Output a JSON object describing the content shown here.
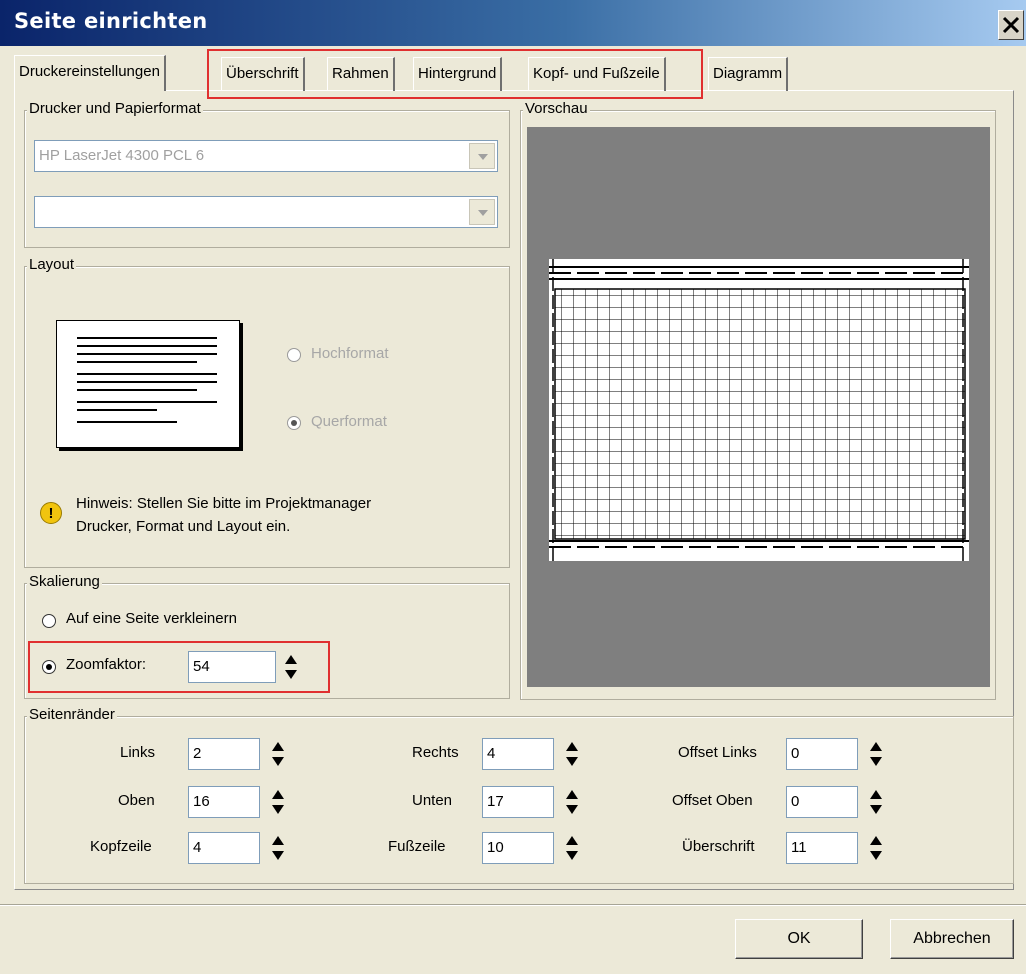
{
  "window": {
    "title": "Seite einrichten"
  },
  "tabs": [
    {
      "label": "Druckereinstellungen",
      "active": true
    },
    {
      "label": "Überschrift"
    },
    {
      "label": "Rahmen"
    },
    {
      "label": "Hintergrund"
    },
    {
      "label": "Kopf- und Fußzeile"
    },
    {
      "label": "Diagramm"
    }
  ],
  "printer": {
    "group_title": "Drucker und Papierformat",
    "printer_value": "HP LaserJet 4300 PCL 6",
    "paper_value": ""
  },
  "layout": {
    "group_title": "Layout",
    "portrait_label": "Hochformat",
    "landscape_label": "Querformat",
    "selected": "Querformat",
    "hint": "Hinweis: Stellen Sie bitte im Projektmanager",
    "hint_line2": "Drucker, Format und Layout ein."
  },
  "scaling": {
    "group_title": "Skalierung",
    "fit_label": "Auf eine Seite verkleinern",
    "zoom_label": "Zoomfaktor:",
    "zoom_value": "54",
    "selected": "Zoomfaktor"
  },
  "preview": {
    "group_title": "Vorschau"
  },
  "margins": {
    "group_title": "Seitenränder",
    "fields": [
      {
        "label": "Links",
        "value": "2"
      },
      {
        "label": "Oben",
        "value": "16"
      },
      {
        "label": "Kopfzeile",
        "value": "4"
      },
      {
        "label": "Rechts",
        "value": "4"
      },
      {
        "label": "Unten",
        "value": "17"
      },
      {
        "label": "Fußzeile",
        "value": "10"
      },
      {
        "label": "Offset Links",
        "value": "0"
      },
      {
        "label": "Offset Oben",
        "value": "0"
      },
      {
        "label": "Überschrift",
        "value": "11"
      }
    ]
  },
  "buttons": {
    "ok": "OK",
    "cancel": "Abbrechen"
  },
  "colors": {
    "titlebar_start": "#0a246a",
    "highlight": "#e03030",
    "dialog_bg": "#ece9d8"
  }
}
